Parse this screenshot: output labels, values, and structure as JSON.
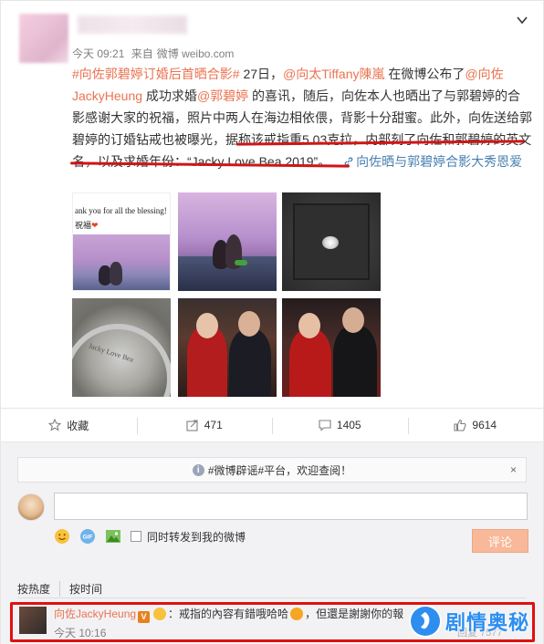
{
  "post": {
    "time": "今天 09:21",
    "source_prefix": "来自",
    "source": "微博 weibo.com",
    "hashtag": "#向佐郭碧婷订婚后首晒合影#",
    "seg1": " 27日，",
    "mention1": "@向太Tiffany陳嵐",
    "seg2": " 在微博公布了",
    "mention2": "@向佐JackyHeung",
    "seg3": " 成功求婚",
    "mention3": "@郭碧婷",
    "seg4": " 的喜讯，随后，向佐本人也晒出了与郭碧婷的合影感谢大家的祝福，照片中两人在海边相依偎，背影十分甜蜜。此外，向佐送给郭碧婷的订婚钻戒也被曝光，",
    "underlined1": "据称该戒指重5.03克拉，内部刻了向佐和郭碧婷的英文名，以及求婚年份：“Jacky Love Bea 2019”",
    "seg5": "。",
    "link_text": "向佐晒与郭碧婷合影大秀恩爱"
  },
  "photos": {
    "p1_text": "ank you for all the blessing!",
    "p1_text2": "祝福"
  },
  "actions": {
    "favorite": "收藏",
    "forward": "471",
    "comment": "1405",
    "like": "9614"
  },
  "comment_box": {
    "notice": "#微博辟谣#平台，欢迎查阅！",
    "close": "×",
    "also_forward": "同时转发到我的微博",
    "submit": "评论"
  },
  "sort": {
    "hot": "按热度",
    "time": "按时间"
  },
  "top_comment": {
    "name": "向佐JackyHeung",
    "badge": "V",
    "text": "：戒指的內容有錯哦哈哈",
    "text2": "，但還是謝謝你的報",
    "time": "今天 10:16",
    "right": "回复  7577"
  },
  "watermark": "剧情奥秘",
  "colors": {
    "link": "#eb7350",
    "accent_blue": "#467fb0",
    "highlight_red": "#d01515"
  }
}
